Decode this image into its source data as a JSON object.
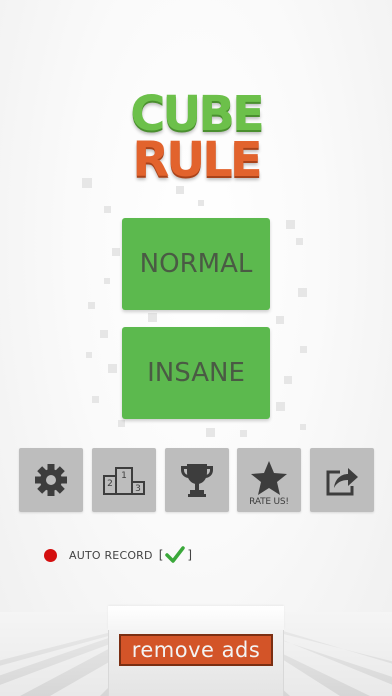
{
  "logo": {
    "line1": "CUBE",
    "line2": "RULE"
  },
  "modes": {
    "normal_label": "NORMAL",
    "insane_label": "INSANE"
  },
  "toolbar": {
    "rate_label": "RATE US!"
  },
  "auto_record": {
    "label": "AUTO RECORD",
    "open_bracket": "[",
    "close_bracket": "]",
    "checked": true
  },
  "ads": {
    "remove_label": "remove ads"
  },
  "colors": {
    "logo_green": "#6cc04a",
    "logo_orange": "#e2632d",
    "mode_button": "#5cb94e",
    "icon_button": "#bdbdbd",
    "record_dot": "#d40f0f",
    "check_green": "#3aa83a",
    "remove_ads_bg": "#d35428"
  },
  "icons": {
    "settings": "gear-icon",
    "leaderboard": "podium-icon",
    "achievements": "trophy-icon",
    "rate": "star-icon",
    "share": "share-icon"
  }
}
